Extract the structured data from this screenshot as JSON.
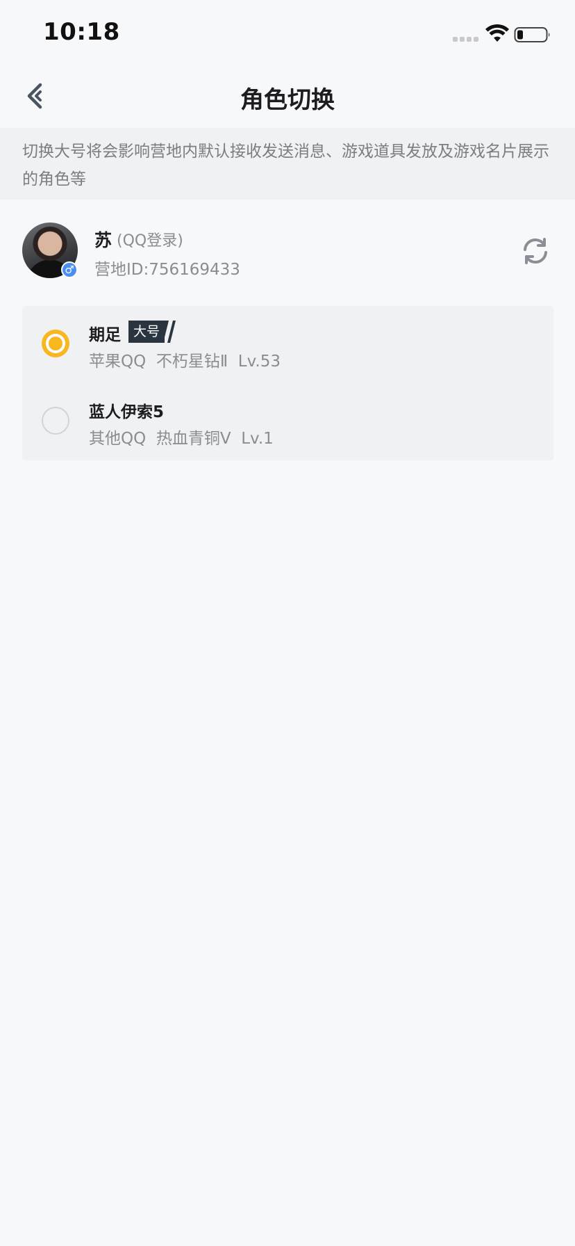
{
  "status_bar": {
    "time": "10:18"
  },
  "nav": {
    "title": "角色切换"
  },
  "notice": {
    "text": "切换大号将会影响营地内默认接收发送消息、游戏道具发放及游戏名片展示的角色等"
  },
  "user": {
    "name": "苏",
    "login_type": "(QQ登录)",
    "camp_id": "营地ID:756169433",
    "gender_symbol": "♂"
  },
  "roles": [
    {
      "name": "期足",
      "tag": "大号",
      "platform": "苹果QQ",
      "rank": "不朽星钻Ⅱ",
      "level": "Lv.53",
      "selected": true
    },
    {
      "name": "蓝人伊索5",
      "tag": "",
      "platform": "其他QQ",
      "rank": "热血青铜Ⅴ",
      "level": "Lv.1",
      "selected": false
    }
  ],
  "colors": {
    "accent": "#f8b621",
    "tag_bg": "#2b3540",
    "gender_badge": "#4a8ff0"
  }
}
